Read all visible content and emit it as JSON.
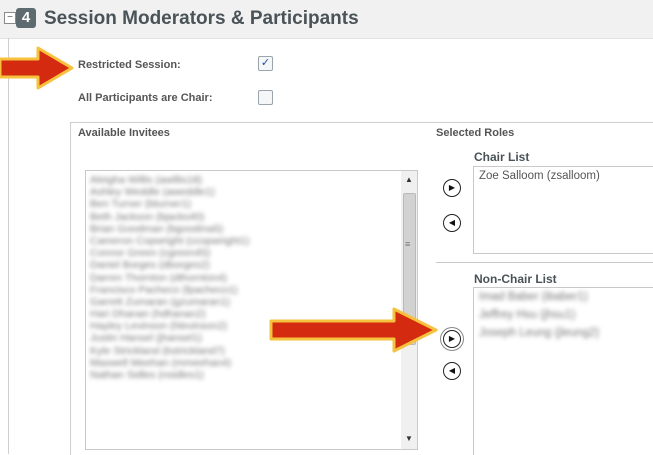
{
  "section": {
    "step_number": "4",
    "title": "Session Moderators & Participants",
    "collapse_symbol": "−"
  },
  "options": {
    "restricted_label": "Restricted Session:",
    "restricted_checked": "✓",
    "all_chair_label": "All Participants are Chair:",
    "all_chair_checked": ""
  },
  "invitees": {
    "heading": "Available Invitees",
    "items": [
      "Aleigha Willis (awillis18)",
      "Ashley Weddle (aweddle1)",
      "Ben Turner (bturner1)",
      "Beth Jackson (bjacks40)",
      "Brian Goodman (bgoodma5)",
      "Cameron Copwright (ccopwright1)",
      "Connor Green (cgreen45)",
      "Daniel Borges (dborges2)",
      "Darren Thornton (dthornton4)",
      "Francisco Pacheco (fpacheco1)",
      "Garrett Zumaran (gzumaran1)",
      "Hari Dhanan (hdhanan2)",
      "Hayley Levinson (hlevinson2)",
      "Justin Hansel (jhansel1)",
      "Kyle Strickland (kstrickland7)",
      "Maxwell Meehan (mmeehan4)",
      "Nathan Sidles (nsidles1)"
    ]
  },
  "roles": {
    "heading": "Selected Roles",
    "chair_label": "Chair List",
    "chair_items": [
      "Zoe Salloom (zsalloom)"
    ],
    "nonchair_label": "Non-Chair List",
    "nonchair_items": [
      "Imad Baber (ibaber1)",
      "Jeffrey Hsu (jhsu1)",
      "Joseph Leung (jleung2)"
    ]
  },
  "icons": {
    "right": "▶",
    "left": "◀",
    "up": "▲",
    "down": "▼",
    "grip": "≡"
  },
  "colors": {
    "arrow_fill": "#d42a0f",
    "arrow_outline": "#f6c23e"
  }
}
